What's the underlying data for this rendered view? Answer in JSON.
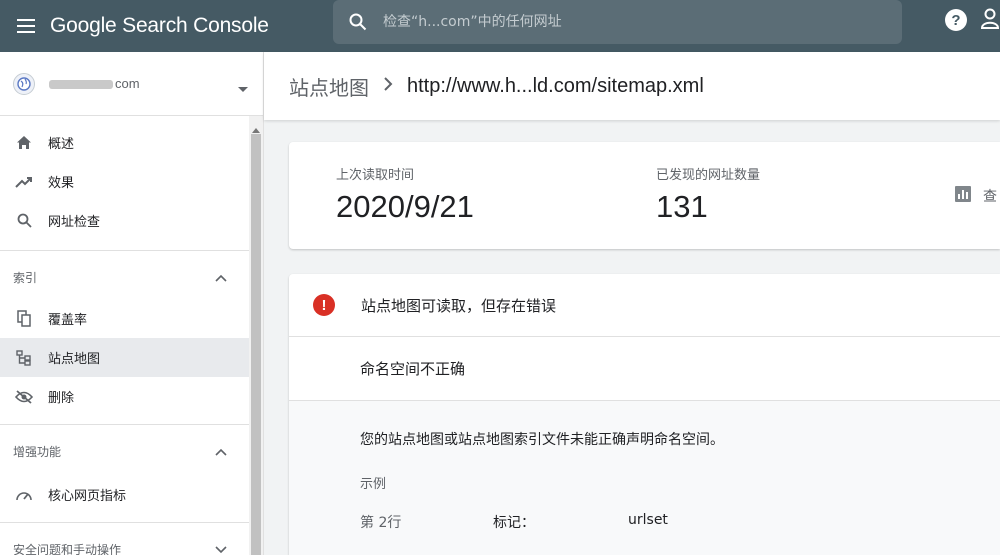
{
  "app": {
    "title": "Google Search Console",
    "search_placeholder": "检查“h...com”中的任何网址",
    "brand_color": "#455a64"
  },
  "sidebar": {
    "property_suffix": "com",
    "nav_top": [
      {
        "label": "概述",
        "icon": "home-icon"
      },
      {
        "label": "效果",
        "icon": "trending-icon"
      },
      {
        "label": "网址检查",
        "icon": "search-icon"
      }
    ],
    "section_index": {
      "title": "索引",
      "items": [
        {
          "label": "覆盖率",
          "icon": "copy-icon"
        },
        {
          "label": "站点地图",
          "icon": "sitemap-icon",
          "active": true
        },
        {
          "label": "删除",
          "icon": "eye-off-icon"
        }
      ]
    },
    "section_enhance": {
      "title": "增强功能",
      "items": [
        {
          "label": "核心网页指标",
          "icon": "gauge-icon"
        }
      ]
    },
    "section_security": {
      "title": "安全问题和手动操作"
    }
  },
  "header": {
    "crumb": "站点地图",
    "url": "http://www.h...ld.com/sitemap.xml"
  },
  "stats": {
    "last_read_label": "上次读取时间",
    "last_read_value": "2020/9/21",
    "discovered_label": "已发现的网址数量",
    "discovered_value": "131",
    "view_label": "查"
  },
  "errors": {
    "status": "站点地图可读取，但存在错误",
    "issue_title": "命名空间不正确",
    "description": "您的站点地图或站点地图索引文件未能正确声明命名空间。",
    "example_label": "示例",
    "line_label": "第 2行",
    "tag_label": "标记：",
    "tag_value": "urlset",
    "error_color": "#d93025"
  }
}
